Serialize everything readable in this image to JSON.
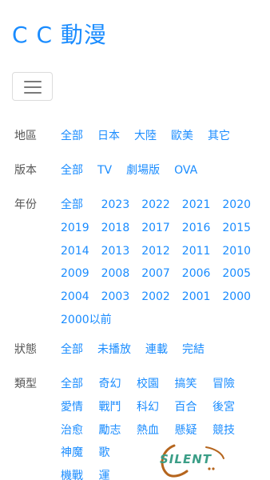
{
  "brand": {
    "title": "C C 動漫"
  },
  "navbar": {
    "toggle_icon": "hamburger-icon"
  },
  "filters": [
    {
      "label": "地區",
      "options": [
        "全部",
        "日本",
        "大陸",
        "歐美",
        "其它"
      ]
    },
    {
      "label": "版本",
      "options": [
        "全部",
        "TV",
        "劇場版",
        "OVA"
      ]
    },
    {
      "label": "年份",
      "options": [
        "全部",
        "2023",
        "2022",
        "2021",
        "2020",
        "2019",
        "2018",
        "2017",
        "2016",
        "2015",
        "2014",
        "2013",
        "2012",
        "2011",
        "2010",
        "2009",
        "2008",
        "2007",
        "2006",
        "2005",
        "2004",
        "2003",
        "2002",
        "2001",
        "2000",
        "2000以前"
      ]
    },
    {
      "label": "狀態",
      "options": [
        "全部",
        "未播放",
        "連載",
        "完結"
      ]
    },
    {
      "label": "類型",
      "options": [
        "全部",
        "奇幻",
        "校園",
        "搞笑",
        "冒險",
        "愛情",
        "戰鬥",
        "科幻",
        "百合",
        "後宮",
        "治愈",
        "勵志",
        "熱血",
        "懸疑",
        "競技",
        "神魔",
        "歌",
        "機戰",
        "運"
      ]
    }
  ],
  "watermark": {
    "text": "SILENT"
  },
  "colors": {
    "link": "#1a8cff",
    "label": "#555555",
    "watermark": "#3b9e87",
    "watermark_swoosh": "#b5651d"
  }
}
